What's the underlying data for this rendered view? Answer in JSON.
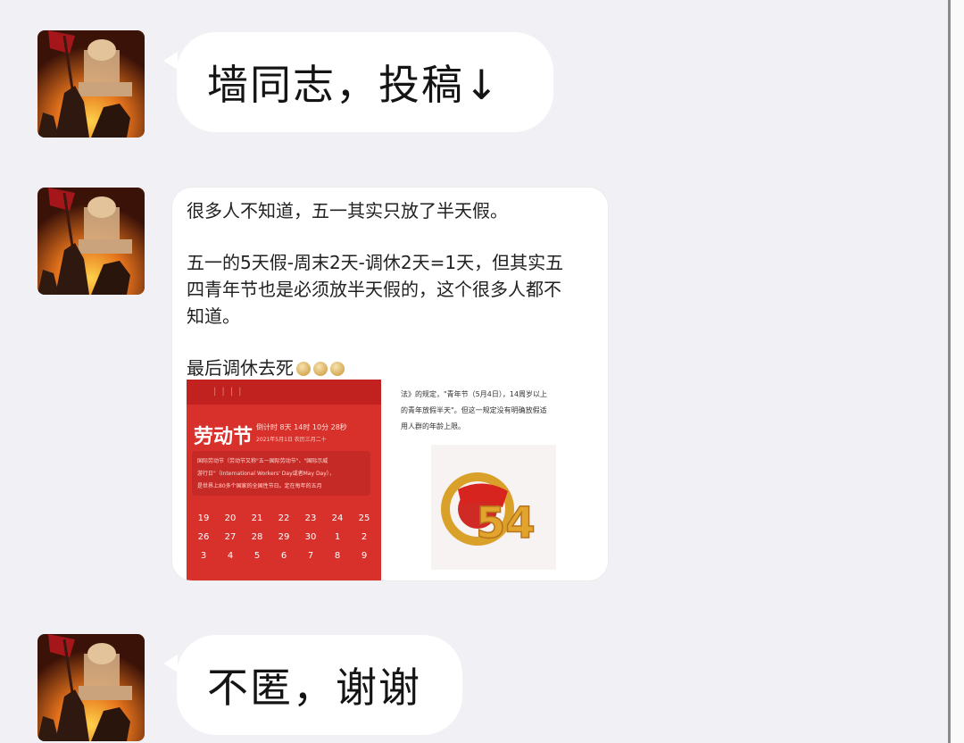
{
  "messages": [
    {
      "avatar_icon": "burning-building-flag-avatar",
      "text": "墙同志，投稿↓"
    },
    {
      "avatar_icon": "burning-building-flag-avatar",
      "post": {
        "line1": "很多人不知道，五一其实只放了半天假。",
        "line2": "五一的5天假-周末2天-调休2天=1天，但其实五",
        "line3": "四青年节也是必须放半天假的，这个很多人都不",
        "line4": "知道。",
        "line5": "最后调休去死",
        "emoji": "fist-emoji"
      },
      "image_calendar": {
        "title": "劳动节",
        "countdown": "倒计时 8天 14时 10分 28秒",
        "date": "2021年5月1日  农历三月二十",
        "note_line1": "国际劳动节（劳动节又称\"五一国际劳动节\"、\"国际示威",
        "note_line2": "游行日\"（International Workers' Day或者May Day），",
        "note_line3": "是世界上80多个国家的全国性节日。定在每年的五月",
        "days": [
          "19",
          "20",
          "21",
          "22",
          "23",
          "24",
          "25",
          "26",
          "27",
          "28",
          "29",
          "30",
          "1",
          "2",
          "3",
          "4",
          "5",
          "6",
          "7",
          "8",
          "9"
        ]
      },
      "image_doc": {
        "text1": "法》的规定，\"青年节（5月4日），14周岁以上",
        "text2": "的青年放假半天\"。但这一规定没有明确放假适",
        "text3": "用人群的年龄上限。",
        "emblem_number": "54"
      }
    },
    {
      "avatar_icon": "burning-building-flag-avatar",
      "text": "不匿，谢谢"
    }
  ],
  "colors": {
    "background": "#f1f1f5",
    "bubble": "#ffffff",
    "calendar_red": "#d8312c"
  }
}
